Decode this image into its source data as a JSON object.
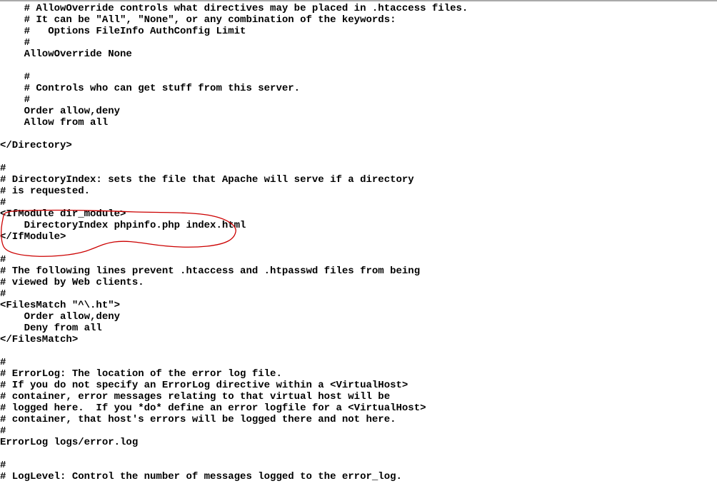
{
  "config_text": "    # AllowOverride controls what directives may be placed in .htaccess files.\n    # It can be \"All\", \"None\", or any combination of the keywords:\n    #   Options FileInfo AuthConfig Limit\n    #\n    AllowOverride None\n\n    #\n    # Controls who can get stuff from this server.\n    #\n    Order allow,deny\n    Allow from all\n\n</Directory>\n\n#\n# DirectoryIndex: sets the file that Apache will serve if a directory\n# is requested.\n#\n<IfModule dir_module>\n    DirectoryIndex phpinfo.php index.html\n</IfModule>\n\n#\n# The following lines prevent .htaccess and .htpasswd files from being\n# viewed by Web clients.\n#\n<FilesMatch \"^\\.ht\">\n    Order allow,deny\n    Deny from all\n</FilesMatch>\n\n#\n# ErrorLog: The location of the error log file.\n# If you do not specify an ErrorLog directive within a <VirtualHost>\n# container, error messages relating to that virtual host will be\n# logged here.  If you *do* define an error logfile for a <VirtualHost>\n# container, that host's errors will be logged there and not here.\n#\nErrorLog logs/error.log\n\n#\n# LogLevel: Control the number of messages logged to the error_log.",
  "annotation": {
    "description": "hand-drawn-circle-highlight",
    "color": "#cc0000"
  }
}
